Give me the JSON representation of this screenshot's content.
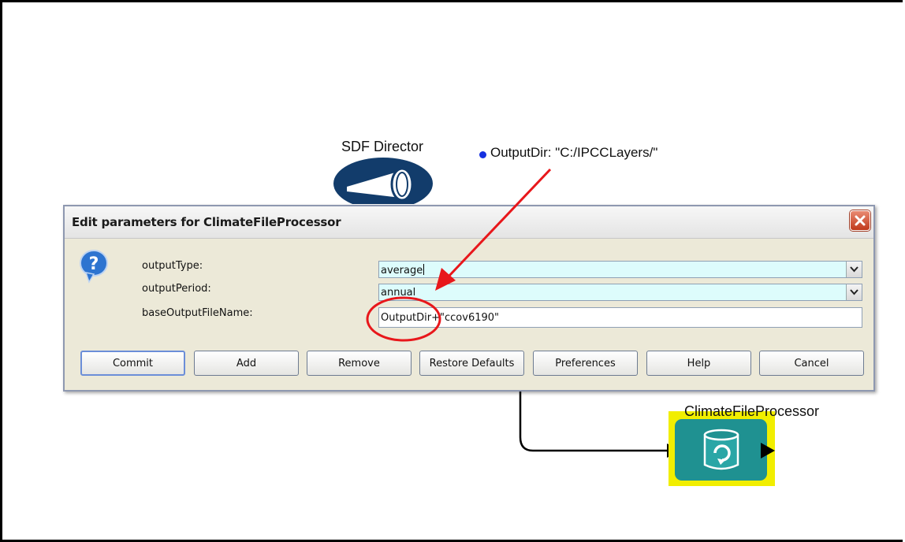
{
  "canvas": {
    "director_label": "SDF Director",
    "parameter_text": "OutputDir: \"C:/IPCCLayers/\"",
    "actor_label": "ClimateFileProcessor"
  },
  "dialog": {
    "title": "Edit parameters for ClimateFileProcessor",
    "fields": [
      {
        "label": "outputType:",
        "value": "average",
        "kind": "combo"
      },
      {
        "label": "outputPeriod:",
        "value": "annual",
        "kind": "combo"
      },
      {
        "label": "baseOutputFileName:",
        "value": "OutputDir+\"ccov6190\"",
        "kind": "text"
      }
    ],
    "buttons": {
      "commit": "Commit",
      "add": "Add",
      "remove": "Remove",
      "restore_defaults": "Restore Defaults",
      "preferences": "Preferences",
      "help": "Help",
      "cancel": "Cancel"
    }
  },
  "colors": {
    "annotation": "#e8171b",
    "actor_highlight": "#f1ee00",
    "actor_fill": "#1f9191",
    "director_fill": "#123c6b",
    "combo_fill": "#ddfcfc"
  },
  "icons": [
    "sdf-director-icon",
    "parameter-dot-icon",
    "close-icon",
    "help-question-icon",
    "dropdown-arrow-icon",
    "refresh-icon",
    "output-port-icon",
    "input-port-icon"
  ]
}
